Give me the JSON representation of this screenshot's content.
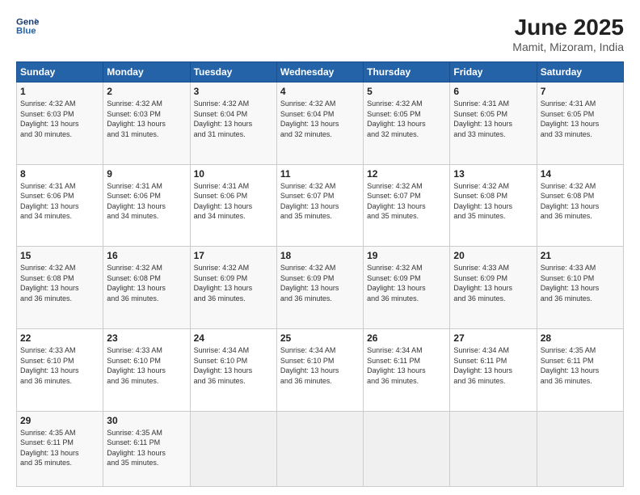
{
  "logo": {
    "line1": "General",
    "line2": "Blue"
  },
  "title": "June 2025",
  "subtitle": "Mamit, Mizoram, India",
  "weekdays": [
    "Sunday",
    "Monday",
    "Tuesday",
    "Wednesday",
    "Thursday",
    "Friday",
    "Saturday"
  ],
  "weeks": [
    [
      {
        "day": "1",
        "info": "Sunrise: 4:32 AM\nSunset: 6:03 PM\nDaylight: 13 hours\nand 30 minutes."
      },
      {
        "day": "2",
        "info": "Sunrise: 4:32 AM\nSunset: 6:03 PM\nDaylight: 13 hours\nand 31 minutes."
      },
      {
        "day": "3",
        "info": "Sunrise: 4:32 AM\nSunset: 6:04 PM\nDaylight: 13 hours\nand 31 minutes."
      },
      {
        "day": "4",
        "info": "Sunrise: 4:32 AM\nSunset: 6:04 PM\nDaylight: 13 hours\nand 32 minutes."
      },
      {
        "day": "5",
        "info": "Sunrise: 4:32 AM\nSunset: 6:05 PM\nDaylight: 13 hours\nand 32 minutes."
      },
      {
        "day": "6",
        "info": "Sunrise: 4:31 AM\nSunset: 6:05 PM\nDaylight: 13 hours\nand 33 minutes."
      },
      {
        "day": "7",
        "info": "Sunrise: 4:31 AM\nSunset: 6:05 PM\nDaylight: 13 hours\nand 33 minutes."
      }
    ],
    [
      {
        "day": "8",
        "info": "Sunrise: 4:31 AM\nSunset: 6:06 PM\nDaylight: 13 hours\nand 34 minutes."
      },
      {
        "day": "9",
        "info": "Sunrise: 4:31 AM\nSunset: 6:06 PM\nDaylight: 13 hours\nand 34 minutes."
      },
      {
        "day": "10",
        "info": "Sunrise: 4:31 AM\nSunset: 6:06 PM\nDaylight: 13 hours\nand 34 minutes."
      },
      {
        "day": "11",
        "info": "Sunrise: 4:32 AM\nSunset: 6:07 PM\nDaylight: 13 hours\nand 35 minutes."
      },
      {
        "day": "12",
        "info": "Sunrise: 4:32 AM\nSunset: 6:07 PM\nDaylight: 13 hours\nand 35 minutes."
      },
      {
        "day": "13",
        "info": "Sunrise: 4:32 AM\nSunset: 6:08 PM\nDaylight: 13 hours\nand 35 minutes."
      },
      {
        "day": "14",
        "info": "Sunrise: 4:32 AM\nSunset: 6:08 PM\nDaylight: 13 hours\nand 36 minutes."
      }
    ],
    [
      {
        "day": "15",
        "info": "Sunrise: 4:32 AM\nSunset: 6:08 PM\nDaylight: 13 hours\nand 36 minutes."
      },
      {
        "day": "16",
        "info": "Sunrise: 4:32 AM\nSunset: 6:08 PM\nDaylight: 13 hours\nand 36 minutes."
      },
      {
        "day": "17",
        "info": "Sunrise: 4:32 AM\nSunset: 6:09 PM\nDaylight: 13 hours\nand 36 minutes."
      },
      {
        "day": "18",
        "info": "Sunrise: 4:32 AM\nSunset: 6:09 PM\nDaylight: 13 hours\nand 36 minutes."
      },
      {
        "day": "19",
        "info": "Sunrise: 4:32 AM\nSunset: 6:09 PM\nDaylight: 13 hours\nand 36 minutes."
      },
      {
        "day": "20",
        "info": "Sunrise: 4:33 AM\nSunset: 6:09 PM\nDaylight: 13 hours\nand 36 minutes."
      },
      {
        "day": "21",
        "info": "Sunrise: 4:33 AM\nSunset: 6:10 PM\nDaylight: 13 hours\nand 36 minutes."
      }
    ],
    [
      {
        "day": "22",
        "info": "Sunrise: 4:33 AM\nSunset: 6:10 PM\nDaylight: 13 hours\nand 36 minutes."
      },
      {
        "day": "23",
        "info": "Sunrise: 4:33 AM\nSunset: 6:10 PM\nDaylight: 13 hours\nand 36 minutes."
      },
      {
        "day": "24",
        "info": "Sunrise: 4:34 AM\nSunset: 6:10 PM\nDaylight: 13 hours\nand 36 minutes."
      },
      {
        "day": "25",
        "info": "Sunrise: 4:34 AM\nSunset: 6:10 PM\nDaylight: 13 hours\nand 36 minutes."
      },
      {
        "day": "26",
        "info": "Sunrise: 4:34 AM\nSunset: 6:11 PM\nDaylight: 13 hours\nand 36 minutes."
      },
      {
        "day": "27",
        "info": "Sunrise: 4:34 AM\nSunset: 6:11 PM\nDaylight: 13 hours\nand 36 minutes."
      },
      {
        "day": "28",
        "info": "Sunrise: 4:35 AM\nSunset: 6:11 PM\nDaylight: 13 hours\nand 36 minutes."
      }
    ],
    [
      {
        "day": "29",
        "info": "Sunrise: 4:35 AM\nSunset: 6:11 PM\nDaylight: 13 hours\nand 35 minutes."
      },
      {
        "day": "30",
        "info": "Sunrise: 4:35 AM\nSunset: 6:11 PM\nDaylight: 13 hours\nand 35 minutes."
      },
      {
        "day": "",
        "info": ""
      },
      {
        "day": "",
        "info": ""
      },
      {
        "day": "",
        "info": ""
      },
      {
        "day": "",
        "info": ""
      },
      {
        "day": "",
        "info": ""
      }
    ]
  ]
}
